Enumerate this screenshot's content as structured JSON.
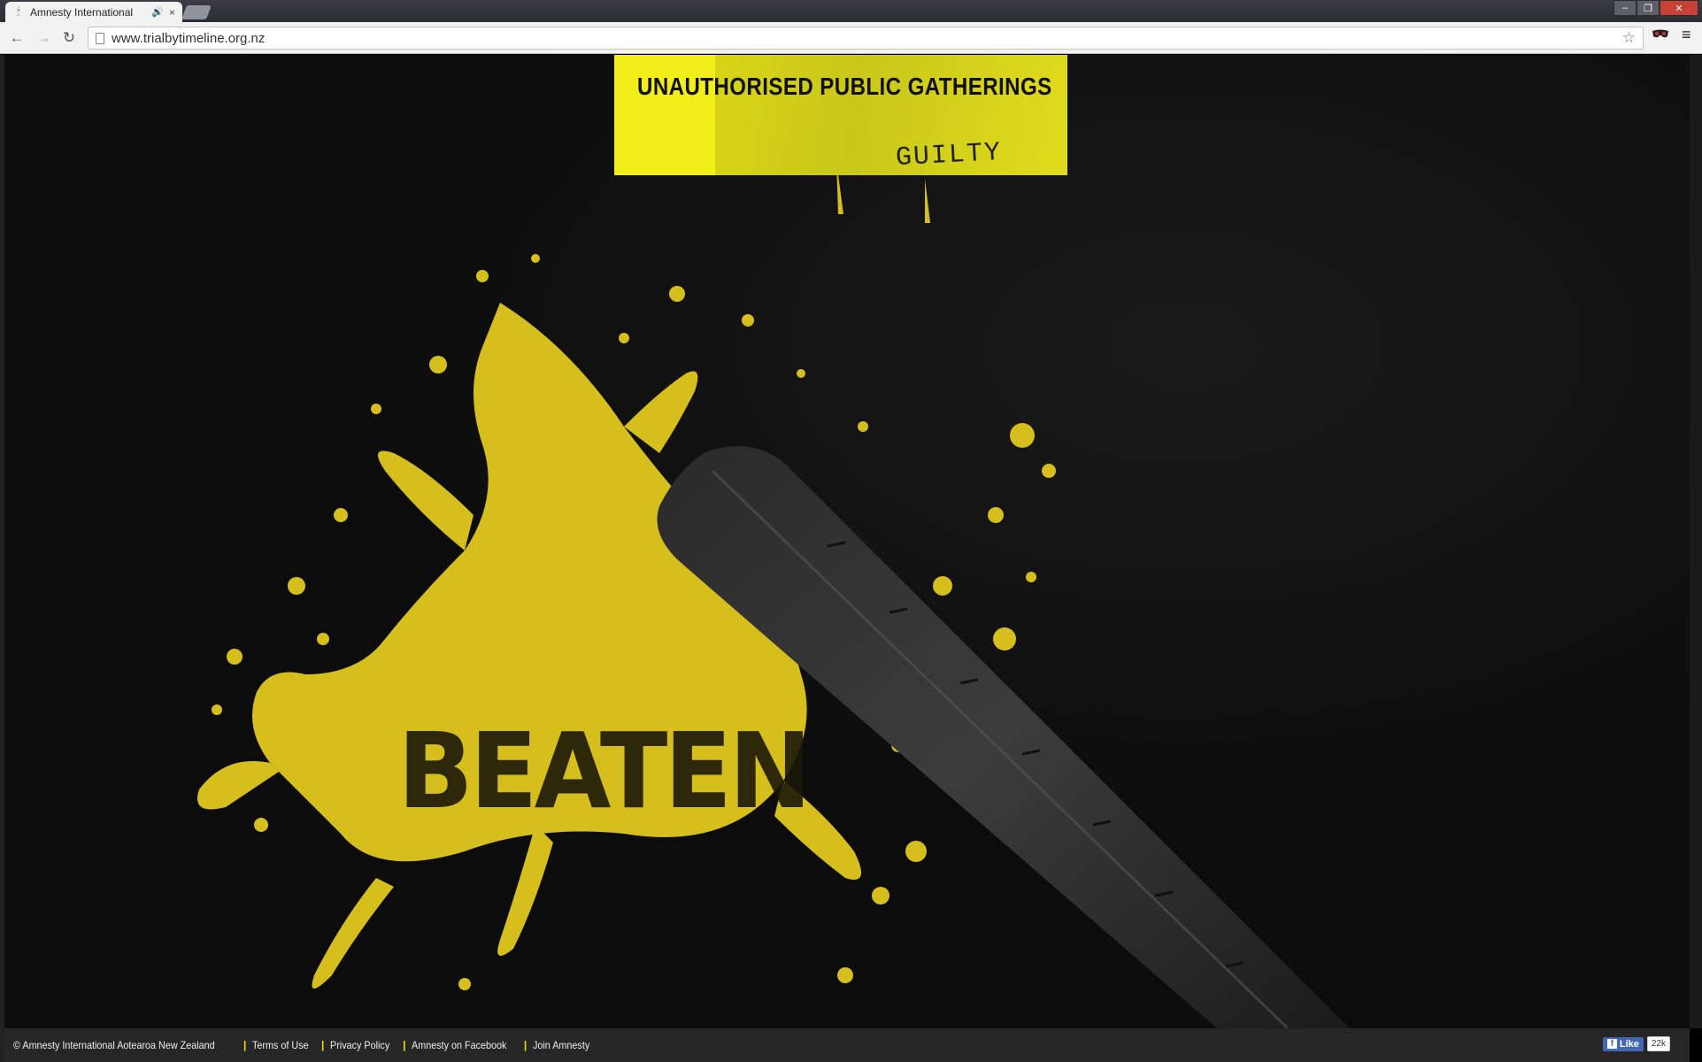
{
  "browser": {
    "tab": {
      "title": "Amnesty International",
      "favicon": "amnesty-candle-icon",
      "audio_icon": "speaker-icon",
      "close": "×"
    },
    "window_controls": {
      "minimize": "–",
      "restore": "❐",
      "close": "✕"
    },
    "nav": {
      "back": "←",
      "forward": "→",
      "reload": "↻"
    },
    "address": "www.trialbytimeline.org.nz",
    "bookmark_star": "☆",
    "extension_icon": "mask-icon",
    "menu_icon": "≡"
  },
  "page": {
    "banner": {
      "heading": "UNAUTHORISED PUBLIC GATHERINGS",
      "verdict": "GUILTY",
      "background_color": "#f1ee1a"
    },
    "hero": {
      "word": "BEATEN",
      "splash_color": "#d9c21a",
      "icon": "baton-icon"
    },
    "footer": {
      "links": [
        "© Amnesty International Aotearoa New Zealand",
        "Terms of Use",
        "Privacy Policy",
        "Amnesty on Facebook",
        "Join Amnesty"
      ],
      "separator_color": "#f1e300",
      "facebook": {
        "like_label": "Like",
        "count": "22k"
      }
    }
  }
}
